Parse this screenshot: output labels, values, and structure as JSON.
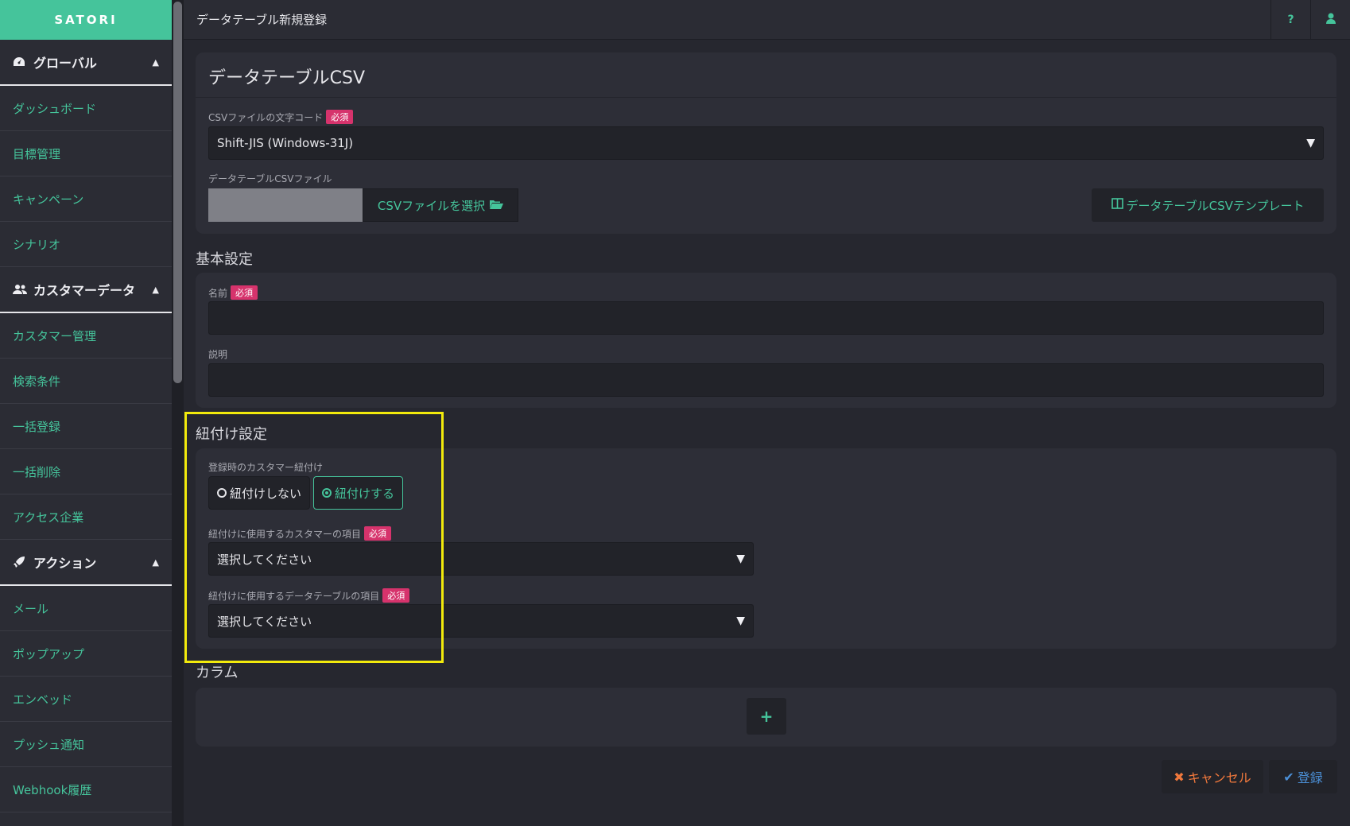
{
  "brand": "SATORI",
  "sidebar": {
    "sections": [
      {
        "label": "グローバル",
        "icon": "dashboard-icon",
        "items": [
          "ダッシュボード",
          "目標管理",
          "キャンペーン",
          "シナリオ"
        ]
      },
      {
        "label": "カスタマーデータ",
        "icon": "users-icon",
        "items": [
          "カスタマー管理",
          "検索条件",
          "一括登録",
          "一括削除",
          "アクセス企業"
        ]
      },
      {
        "label": "アクション",
        "icon": "rocket-icon",
        "items": [
          "メール",
          "ポップアップ",
          "エンベッド",
          "プッシュ通知",
          "Webhook履歴"
        ]
      }
    ]
  },
  "header": {
    "title": "データテーブル新規登録",
    "help_label": "?",
    "user_icon": "user-icon"
  },
  "csv_panel": {
    "title": "データテーブルCSV",
    "encoding_label": "CSVファイルの文字コード",
    "encoding_value": "Shift-JIS (Windows-31J)",
    "file_label": "データテーブルCSVファイル",
    "file_button": "CSVファイルを選択",
    "template_button": "データテーブルCSVテンプレート"
  },
  "required_badge": "必須",
  "basic": {
    "title": "基本設定",
    "name_label": "名前",
    "description_label": "説明"
  },
  "link": {
    "title": "紐付け設定",
    "mode_label": "登録時のカスタマー紐付け",
    "option_off": "紐付けしない",
    "option_on": "紐付けする",
    "selected": "紐付けする",
    "customer_field_label": "紐付けに使用するカスタマーの項目",
    "customer_field_value": "選択してください",
    "table_field_label": "紐付けに使用するデータテーブルの項目",
    "table_field_value": "選択してください"
  },
  "columns": {
    "title": "カラム",
    "add_label": "+"
  },
  "footer": {
    "cancel_label": "キャンセル",
    "submit_label": "登録"
  },
  "colors": {
    "accent": "#45c49b",
    "required": "#d6336c",
    "highlight": "#f2ea0c",
    "submit": "#4b8fd6",
    "cancel": "#f0783c"
  }
}
